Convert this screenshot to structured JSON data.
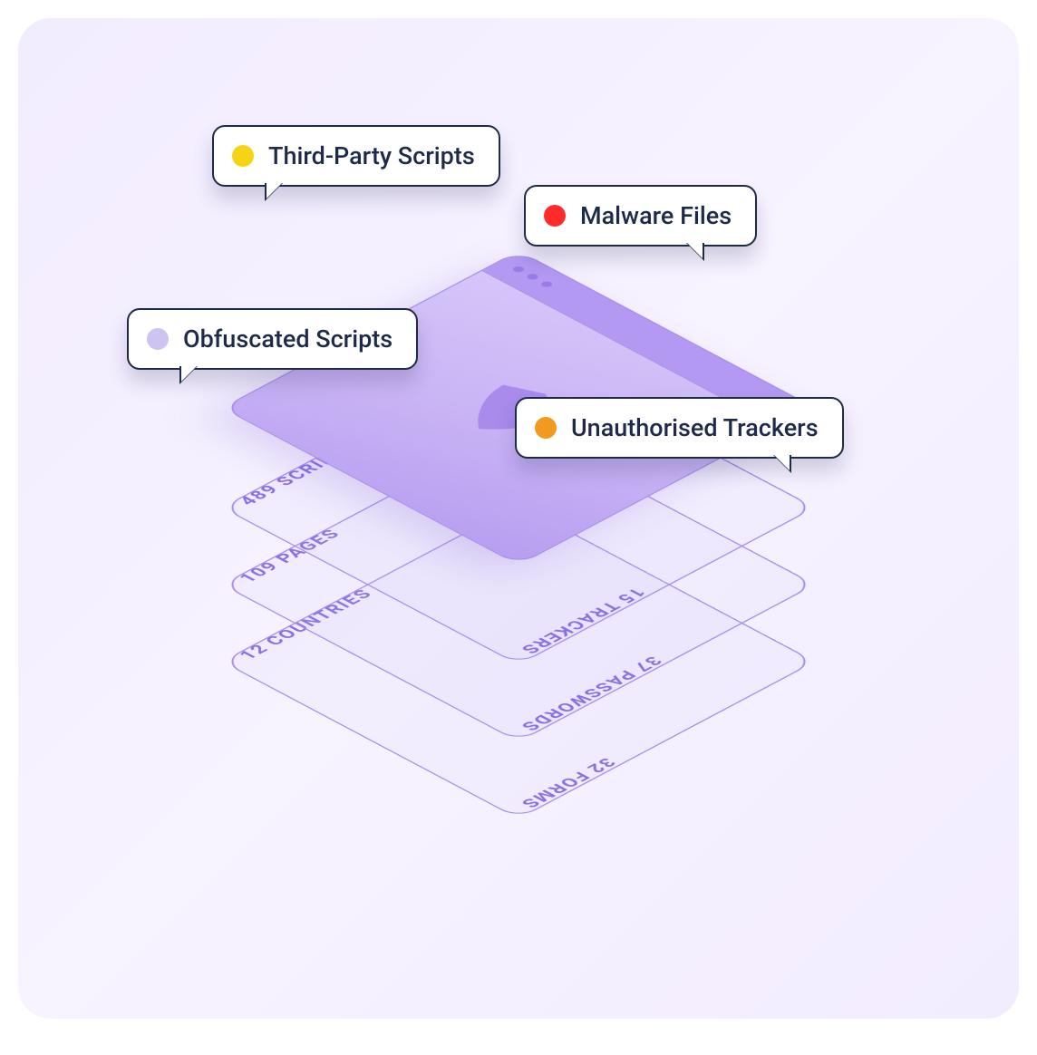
{
  "bubbles": [
    {
      "label": "Third-Party Scripts",
      "color": "#f5d417"
    },
    {
      "label": "Malware Files",
      "color": "#ff2a2a"
    },
    {
      "label": "Obfuscated Scripts",
      "color": "#cfc3f2"
    },
    {
      "label": "Unauthorised Trackers",
      "color": "#f19a1f"
    }
  ],
  "layers": [
    {
      "left": "489 SCRIPTS",
      "right": "15 TRACKERS"
    },
    {
      "left": "109 PAGES",
      "right": "37 PASSWORDS"
    },
    {
      "left": "12 COUNTRIES",
      "right": "32 FORMS"
    }
  ],
  "colors": {
    "layer_border": "#a98df0",
    "browser_bar": "#b399f2",
    "text_dark": "#1e2a4a",
    "layer_text": "#8b6fe3"
  }
}
